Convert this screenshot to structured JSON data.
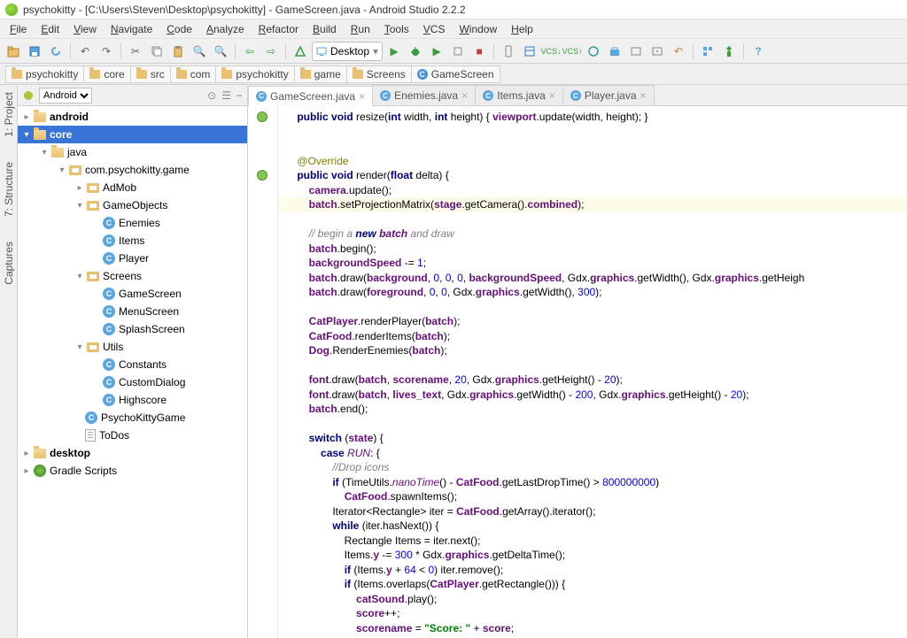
{
  "title": "psychokitty - [C:\\Users\\Steven\\Desktop\\psychokitty] - GameScreen.java - Android Studio 2.2.2",
  "menu": [
    "File",
    "Edit",
    "View",
    "Navigate",
    "Code",
    "Analyze",
    "Refactor",
    "Build",
    "Run",
    "Tools",
    "VCS",
    "Window",
    "Help"
  ],
  "run_config": "Desktop",
  "breadcrumbs": [
    "psychokitty",
    "core",
    "src",
    "com",
    "psychokitty",
    "game",
    "Screens",
    "GameScreen"
  ],
  "panel_dropdown": "Android",
  "tree": {
    "android": "android",
    "core": "core",
    "java": "java",
    "pkg": "com.psychokitty.game",
    "admob": "AdMob",
    "gameobjects": "GameObjects",
    "enemies": "Enemies",
    "items": "Items",
    "player": "Player",
    "screens": "Screens",
    "gamescreen": "GameScreen",
    "menuscreen": "MenuScreen",
    "splashscreen": "SplashScreen",
    "utils": "Utils",
    "constants": "Constants",
    "customdialog": "CustomDialog",
    "highscore": "Highscore",
    "psychokittygame": "PsychoKittyGame",
    "todos": "ToDos",
    "desktop": "desktop",
    "gradle": "Gradle Scripts"
  },
  "side_tabs": {
    "project": "1: Project",
    "structure": "7: Structure",
    "captures": "Captures"
  },
  "tabs": [
    {
      "label": "GameScreen.java",
      "active": true
    },
    {
      "label": "Enemies.java",
      "active": false
    },
    {
      "label": "Items.java",
      "active": false
    },
    {
      "label": "Player.java",
      "active": false
    }
  ],
  "code_lines": [
    {
      "t": "    public void resize(int width, int height) { viewport.update(width, height); }",
      "ov": true
    },
    {
      "t": ""
    },
    {
      "t": ""
    },
    {
      "t": "    @Override"
    },
    {
      "t": "    public void render(float delta) {",
      "ov": true
    },
    {
      "t": "        camera.update();"
    },
    {
      "t": "        batch.setProjectionMatrix(stage.getCamera().combined);",
      "hl": true
    },
    {
      "t": ""
    },
    {
      "t": "        // begin a new batch and draw"
    },
    {
      "t": "        batch.begin();"
    },
    {
      "t": "        backgroundSpeed -= 1;"
    },
    {
      "t": "        batch.draw(background, 0, 0, 0, backgroundSpeed, Gdx.graphics.getWidth(), Gdx.graphics.getHeigh"
    },
    {
      "t": "        batch.draw(foreground, 0, 0, Gdx.graphics.getWidth(), 300);"
    },
    {
      "t": ""
    },
    {
      "t": "        CatPlayer.renderPlayer(batch);"
    },
    {
      "t": "        CatFood.renderItems(batch);"
    },
    {
      "t": "        Dog.RenderEnemies(batch);"
    },
    {
      "t": ""
    },
    {
      "t": "        font.draw(batch, scorename, 20, Gdx.graphics.getHeight() - 20);"
    },
    {
      "t": "        font.draw(batch, lives_text, Gdx.graphics.getWidth() - 200, Gdx.graphics.getHeight() - 20);"
    },
    {
      "t": "        batch.end();"
    },
    {
      "t": ""
    },
    {
      "t": "        switch (state) {"
    },
    {
      "t": "            case RUN: {"
    },
    {
      "t": "                //Drop icons"
    },
    {
      "t": "                if (TimeUtils.nanoTime() - CatFood.getLastDropTime() > 800000000)"
    },
    {
      "t": "                    CatFood.spawnItems();"
    },
    {
      "t": "                Iterator<Rectangle> iter = CatFood.getArray().iterator();"
    },
    {
      "t": "                while (iter.hasNext()) {"
    },
    {
      "t": "                    Rectangle Items = iter.next();"
    },
    {
      "t": "                    Items.y -= 300 * Gdx.graphics.getDeltaTime();"
    },
    {
      "t": "                    if (Items.y + 64 < 0) iter.remove();"
    },
    {
      "t": "                    if (Items.overlaps(CatPlayer.getRectangle())) {"
    },
    {
      "t": "                        catSound.play();"
    },
    {
      "t": "                        score++;"
    },
    {
      "t": "                        scorename = \"Score: \" + score;"
    }
  ]
}
